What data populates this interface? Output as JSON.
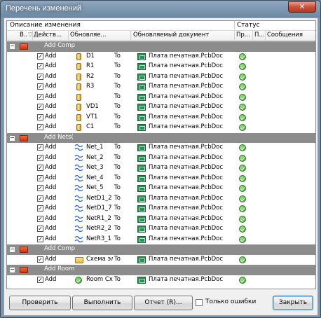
{
  "window": {
    "title": "Перечень изменений",
    "close_glyph": "✕"
  },
  "headers": {
    "group_left": "Описание изменения",
    "group_right": "Статус",
    "col_enable": "В..",
    "col_action": "Действ...",
    "col_affected": "Обновляе...",
    "col_doc": "Обновляемый документ",
    "col_check": "Пр...",
    "col_done": "П...",
    "col_messages": "Сообщения"
  },
  "groups": [
    {
      "label": "Add Comp",
      "rows": [
        {
          "action": "Add",
          "object": "D1",
          "to": "To",
          "doc": "Плата печатная.PcbDoc"
        },
        {
          "action": "Add",
          "object": "R1",
          "to": "To",
          "doc": "Плата печатная.PcbDoc"
        },
        {
          "action": "Add",
          "object": "R2",
          "to": "To",
          "doc": "Плата печатная.PcbDoc"
        },
        {
          "action": "Add",
          "object": "R3",
          "to": "To",
          "doc": "Плата печатная.PcbDoc"
        },
        {
          "action": "Add",
          "object": "",
          "to": "To",
          "doc": "Плата печатная.PcbDoc"
        },
        {
          "action": "Add",
          "object": "VD1",
          "to": "To",
          "doc": "Плата печатная.PcbDoc"
        },
        {
          "action": "Add",
          "object": "VT1",
          "to": "To",
          "doc": "Плата печатная.PcbDoc"
        },
        {
          "action": "Add",
          "object": "C1",
          "to": "To",
          "doc": "Плата печатная.PcbDoc"
        }
      ]
    },
    {
      "label": "Add Nets(",
      "rows": [
        {
          "action": "Add",
          "object": "Net_1",
          "to": "To",
          "doc": "Плата печатная.PcbDoc"
        },
        {
          "action": "Add",
          "object": "Net_2",
          "to": "To",
          "doc": "Плата печатная.PcbDoc"
        },
        {
          "action": "Add",
          "object": "Net_3",
          "to": "To",
          "doc": "Плата печатная.PcbDoc"
        },
        {
          "action": "Add",
          "object": "Net_4",
          "to": "To",
          "doc": "Плата печатная.PcbDoc"
        },
        {
          "action": "Add",
          "object": "Net_5",
          "to": "To",
          "doc": "Плата печатная.PcbDoc"
        },
        {
          "action": "Add",
          "object": "NetD1_2",
          "to": "To",
          "doc": "Плата печатная.PcbDoc"
        },
        {
          "action": "Add",
          "object": "NetD1_7",
          "to": "To",
          "doc": "Плата печатная.PcbDoc"
        },
        {
          "action": "Add",
          "object": "NetR1_2",
          "to": "To",
          "doc": "Плата печатная.PcbDoc"
        },
        {
          "action": "Add",
          "object": "NetR2_2",
          "to": "To",
          "doc": "Плата печатная.PcbDoc"
        },
        {
          "action": "Add",
          "object": "NetR3_1",
          "to": "To",
          "doc": "Плата печатная.PcbDoc"
        }
      ]
    },
    {
      "label": "Add Comp",
      "rows": [
        {
          "action": "Add",
          "object": "Схема эл",
          "to": "To",
          "doc": "Плата печатная.PcbDoc"
        }
      ]
    },
    {
      "label": "Add Room",
      "rows": [
        {
          "action": "Add",
          "object": "Room Сх",
          "to": "To",
          "doc": "Плата печатная.PcbDoc"
        }
      ]
    }
  ],
  "footer": {
    "validate": "Проверить",
    "execute": "Выполнить",
    "report": "Отчет (R)...",
    "only_errors": "Только ошибки",
    "close": "Закрыть"
  },
  "colors": {
    "group_bg": "#8c8c8c",
    "title_bg": "#6d88a3",
    "ok": "#3a9a27"
  }
}
